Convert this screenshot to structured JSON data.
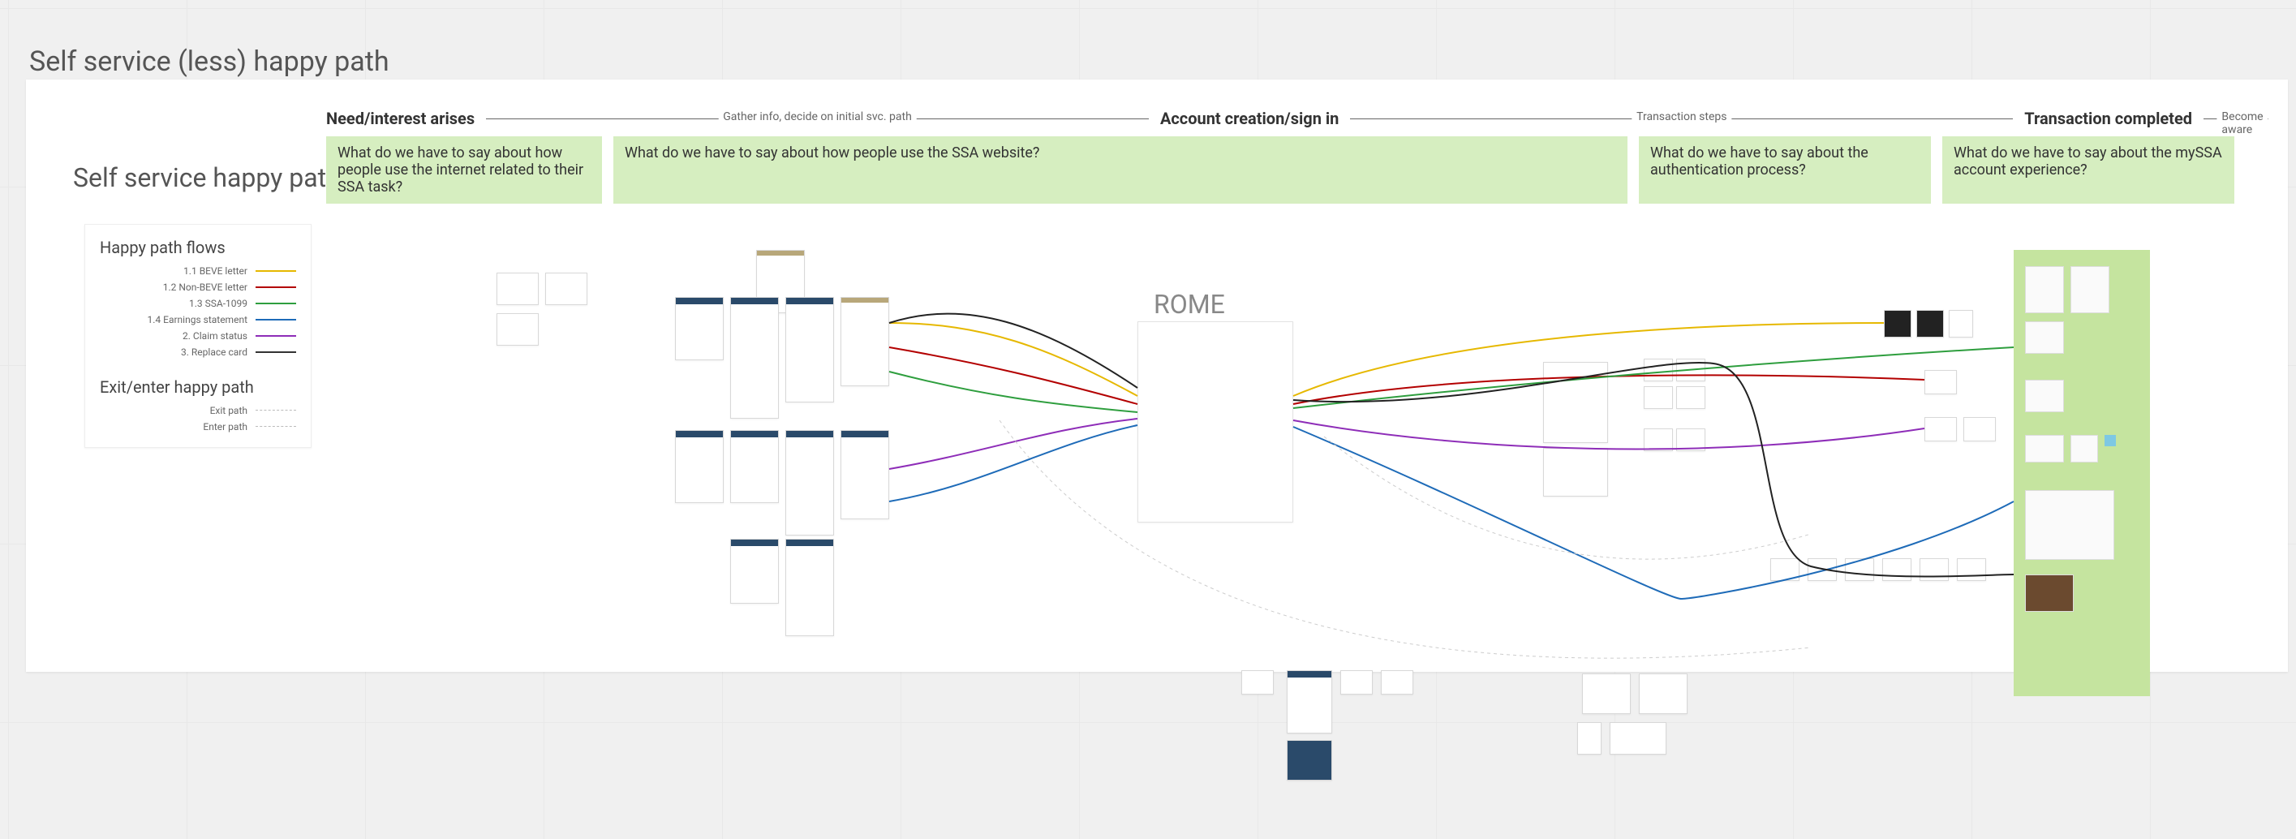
{
  "titles": {
    "outer": "Self service (less) happy path",
    "inner": "Self service happy path"
  },
  "phases": {
    "p1": "Need/interest arises",
    "sub1": "Gather info, decide on initial svc. path",
    "p2": "Account creation/sign in",
    "sub2": "Transaction steps",
    "p3": "Transaction completed",
    "sub3": "Become aware of"
  },
  "notes": {
    "n1": "What do we have to say about how people use the internet related to their SSA task?",
    "n2": "What do we have to say about how people use the SSA website?",
    "n3": "What do we have to say about the authentication process?",
    "n4": "What do we have to say about the mySSA account experience?"
  },
  "legend": {
    "heading1": "Happy path flows",
    "items": [
      {
        "label": "1.1 BEVE letter",
        "color": "#e6b800"
      },
      {
        "label": "1.2 Non-BEVE letter",
        "color": "#b30000"
      },
      {
        "label": "1.3 SSA-1099",
        "color": "#2e9e3e"
      },
      {
        "label": "1.4 Earnings statement",
        "color": "#1e6bb8"
      },
      {
        "label": "2. Claim status",
        "color": "#8e2db8"
      },
      {
        "label": "3. Replace card",
        "color": "#333333"
      }
    ],
    "heading2": "Exit/enter happy path",
    "exit": "Exit path",
    "enter": "Enter path"
  },
  "rome": {
    "label": "ROME"
  }
}
